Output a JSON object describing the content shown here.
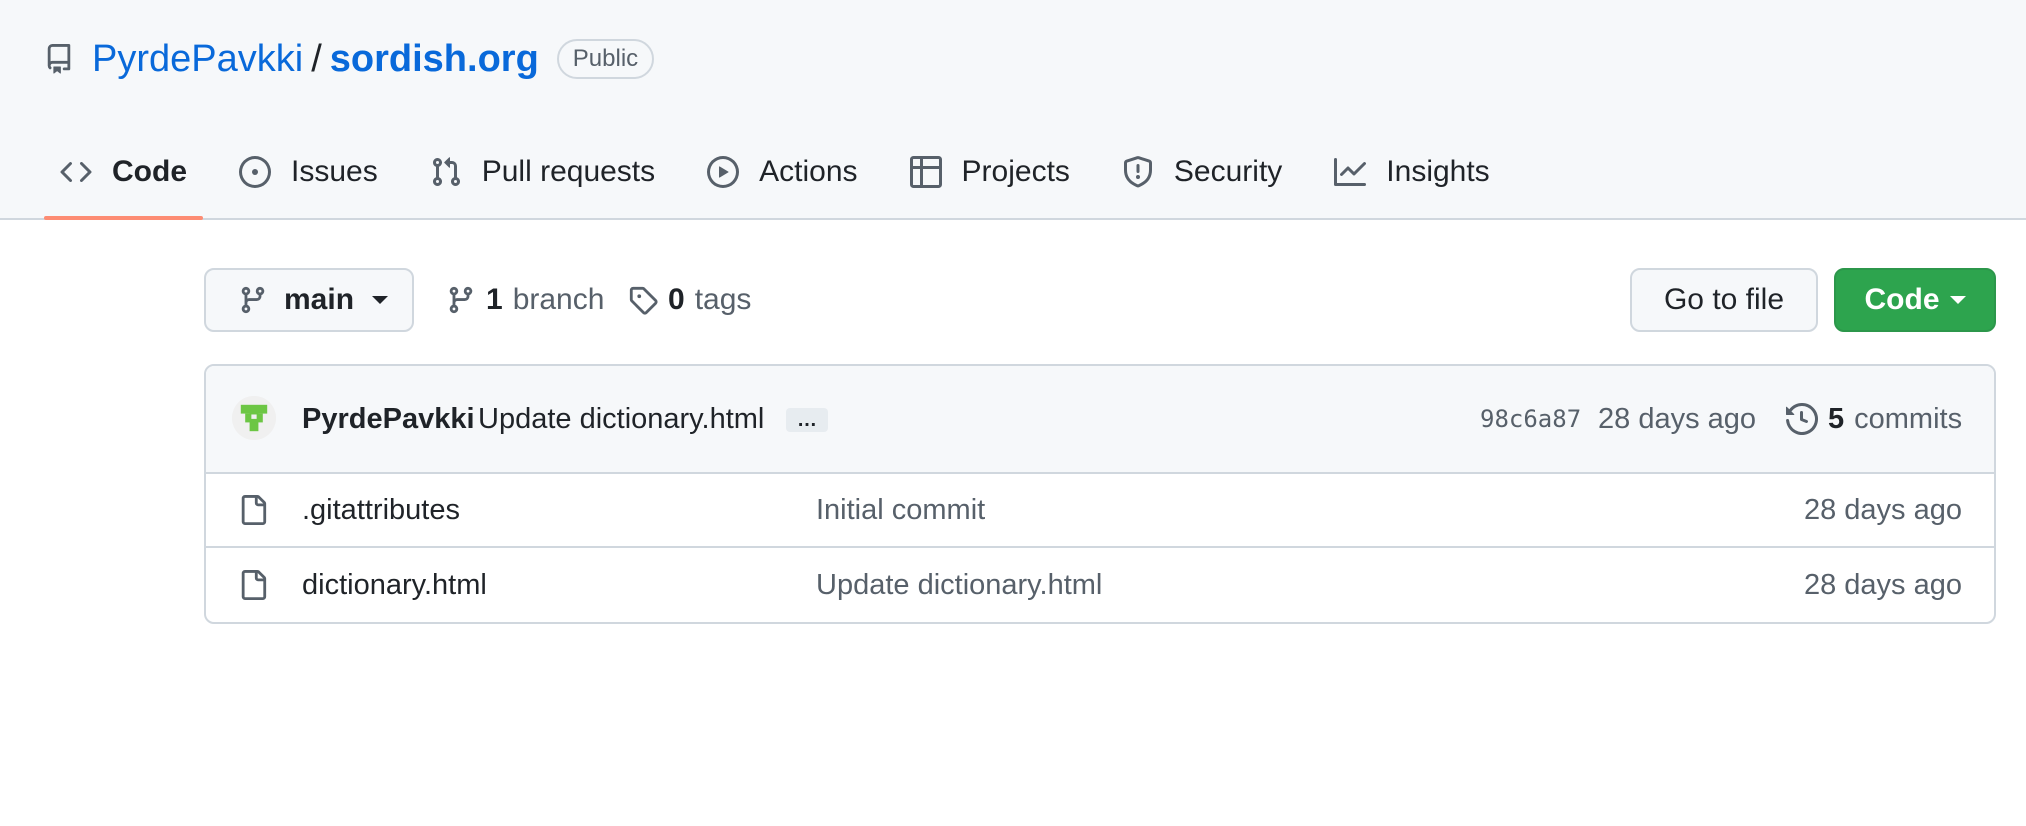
{
  "repo": {
    "owner": "PyrdePavkki",
    "separator": "/",
    "name": "sordish.org",
    "visibility": "Public"
  },
  "tabs": [
    {
      "label": "Code",
      "icon": "code-icon",
      "active": true
    },
    {
      "label": "Issues",
      "icon": "issue-opened-icon"
    },
    {
      "label": "Pull requests",
      "icon": "git-pull-request-icon"
    },
    {
      "label": "Actions",
      "icon": "play-icon"
    },
    {
      "label": "Projects",
      "icon": "table-icon"
    },
    {
      "label": "Security",
      "icon": "shield-icon"
    },
    {
      "label": "Insights",
      "icon": "graph-icon"
    }
  ],
  "toolbar": {
    "branch": "main",
    "branch_count": "1",
    "branch_label": "branch",
    "tag_count": "0",
    "tag_label": "tags",
    "goto_file": "Go to file",
    "code_button": "Code"
  },
  "latest_commit": {
    "author": "PyrdePavkki",
    "message": "Update dictionary.html",
    "ellipsis": "…",
    "hash": "98c6a87",
    "time": "28 days ago",
    "commit_count": "5",
    "commit_label": "commits"
  },
  "files": [
    {
      "name": ".gitattributes",
      "commit": "Initial commit",
      "time": "28 days ago",
      "icon": "file-icon"
    },
    {
      "name": "dictionary.html",
      "commit": "Update dictionary.html",
      "time": "28 days ago",
      "icon": "file-icon"
    }
  ],
  "colors": {
    "link": "#0969da",
    "accent_underline": "#fd8c73",
    "code_button": "#2da44e",
    "avatar": "#6cc644"
  }
}
